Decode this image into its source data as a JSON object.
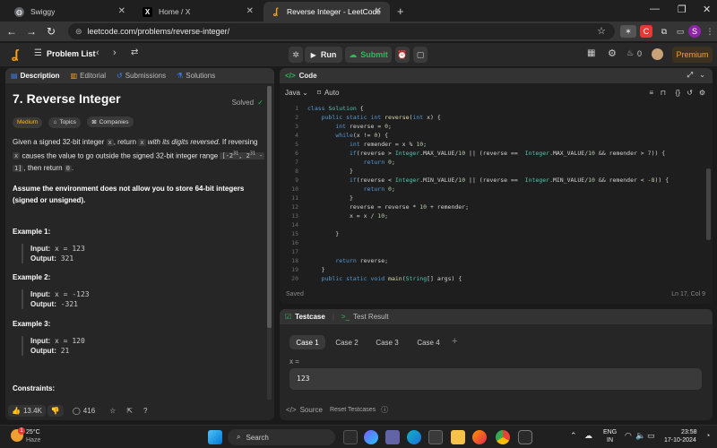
{
  "browser": {
    "tabs": [
      {
        "title": "Swiggy",
        "favicon": "globe-icon",
        "color": "#5f6368"
      },
      {
        "title": "Home / X",
        "favicon": "x-icon",
        "color": "#000000"
      },
      {
        "title": "Reverse Integer - LeetCode",
        "favicon": "leetcode-icon",
        "color": "#ffa116"
      }
    ],
    "url": "leetcode.com/problems/reverse-integer/",
    "profile_letter": "S"
  },
  "header": {
    "problem_list": "Problem List",
    "run": "Run",
    "submit": "Submit",
    "streak": "0",
    "premium": "Premium"
  },
  "left_tabs": [
    "Description",
    "Editorial",
    "Submissions",
    "Solutions"
  ],
  "problem": {
    "title": "7. Reverse Integer",
    "solved": "Solved",
    "difficulty": "Medium",
    "chips": [
      "Topics",
      "Companies"
    ],
    "p1_a": "Given a signed 32-bit integer ",
    "p1_code1": "x",
    "p1_b": ", return ",
    "p1_code2": "x",
    "p1_c": " with its digits reversed",
    "p1_d": ". If reversing ",
    "p1_code3": "x",
    "p1_e": " causes the value to go outside the signed 32-bit integer range ",
    "p1_range_a": "[-2",
    "p1_exp1": "31",
    "p1_range_b": ", 2",
    "p1_exp2": "31",
    "p1_range_c": " -",
    "p1_range_d": "1]",
    "p1_f": ", then return ",
    "p1_code4": "0",
    "p1_g": ".",
    "p2": "Assume the environment does not allow you to store 64-bit integers (signed or unsigned).",
    "examples": [
      {
        "heading": "Example 1:",
        "input": "x = 123",
        "output": "321"
      },
      {
        "heading": "Example 2:",
        "input": "x = -123",
        "output": "-321"
      },
      {
        "heading": "Example 3:",
        "input": "x = 120",
        "output": "21"
      }
    ],
    "input_label": "Input:",
    "output_label": "Output:",
    "constraints": "Constraints:"
  },
  "left_footer": {
    "likes": "13.4K",
    "comments": "416"
  },
  "code": {
    "tab": "Code",
    "language": "Java",
    "auto": "Auto",
    "lines": [
      {
        "n": "1",
        "t": "class Solution {"
      },
      {
        "n": "2",
        "t": "    public static int reverse(int x) {"
      },
      {
        "n": "3",
        "t": "        int reverse = 0;"
      },
      {
        "n": "4",
        "t": "        while(x != 0) {"
      },
      {
        "n": "5",
        "t": "            int remender = x % 10;"
      },
      {
        "n": "6",
        "t": "            if(reverse > Integer.MAX_VALUE/10 || (reverse ==  Integer.MAX_VALUE/10 && remender > 7)) {"
      },
      {
        "n": "7",
        "t": "                return 0;"
      },
      {
        "n": "8",
        "t": "            }"
      },
      {
        "n": "9",
        "t": "            if(reverse < Integer.MIN_VALUE/10 || (reverse ==  Integer.MIN_VALUE/10 && remender < -8)) {"
      },
      {
        "n": "10",
        "t": "                return 0;"
      },
      {
        "n": "11",
        "t": "            }"
      },
      {
        "n": "12",
        "t": "            reverse = reverse * 10 + remender;"
      },
      {
        "n": "13",
        "t": "            x = x / 10;"
      },
      {
        "n": "14",
        "t": ""
      },
      {
        "n": "15",
        "t": "        }"
      },
      {
        "n": "16",
        "t": ""
      },
      {
        "n": "17",
        "t": ""
      },
      {
        "n": "18",
        "t": "        return reverse;"
      },
      {
        "n": "19",
        "t": "    }"
      },
      {
        "n": "20",
        "t": "    public static void main(String[] args) {"
      }
    ],
    "status": "Saved",
    "position": "Ln 17, Col 9"
  },
  "testcase": {
    "tab": "Testcase",
    "result_tab": "Test Result",
    "cases": [
      "Case 1",
      "Case 2",
      "Case 3",
      "Case 4"
    ],
    "var_label": "x =",
    "value": "123",
    "source": "Source",
    "reset": "Reset Testcases"
  },
  "taskbar": {
    "temp": "25°C",
    "weather": "Haze",
    "search": "Search",
    "lang1": "ENG",
    "lang2": "IN",
    "time": "23:58",
    "date": "17-10-2024"
  }
}
